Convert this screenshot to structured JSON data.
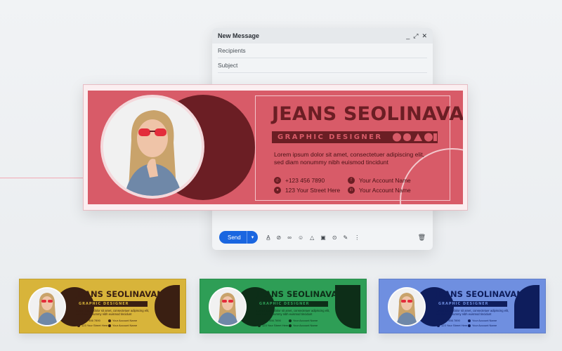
{
  "compose": {
    "title": "New Message",
    "recipients_placeholder": "Recipients",
    "subject_placeholder": "Subject",
    "send_label": "Send"
  },
  "signature": {
    "name": "JEANS SEOLINAVANA",
    "role": "GRAPHIC DESIGNER",
    "description": "Lorem ipsum dolor sit amet, consectetuer adipiscing elit, sed diam nonummy nibh euismod tincidunt",
    "phone": "+123 456 7890",
    "address": "123 Your Street Here",
    "facebook": "Your Account Name",
    "linkedin": "Your Account Name"
  },
  "variants": [
    {
      "accent": "#d8b43a",
      "dark": "#3a1f12"
    },
    {
      "accent": "#2e9e56",
      "dark": "#0d2e18"
    },
    {
      "accent": "#6f8fe0",
      "dark": "#0e1d5c"
    }
  ],
  "colors": {
    "main_accent": "#d85b68",
    "main_dark": "#6b1e24",
    "send_button": "#1a66e0"
  },
  "icons": [
    "minimize-icon",
    "expand-icon",
    "close-icon",
    "text-format-icon",
    "attach-icon",
    "link-icon",
    "emoji-icon",
    "drive-icon",
    "image-icon",
    "lock-icon",
    "pen-icon",
    "more-icon",
    "trash-icon",
    "whatsapp-icon",
    "facebook-icon",
    "location-icon",
    "linkedin-icon"
  ]
}
